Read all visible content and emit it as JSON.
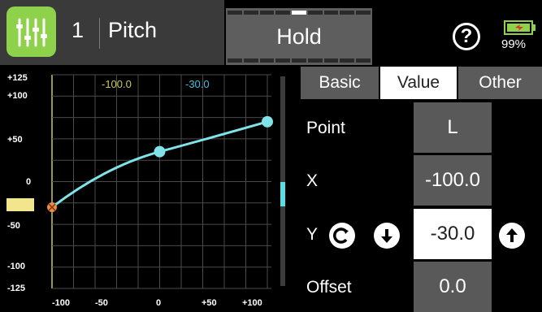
{
  "header": {
    "model_number": "1",
    "function_name": "Pitch",
    "mode_label": "Hold",
    "help_label": "?",
    "battery_percent": "99%"
  },
  "graph": {
    "y_ticks": [
      "+125",
      "+100",
      "+50",
      "0",
      "-50",
      "-100",
      "-125"
    ],
    "x_ticks": [
      "-100",
      "-50",
      "0",
      "+50",
      "+100"
    ],
    "cursor_x_value": "-100.0",
    "cursor_y_value": "-30.0"
  },
  "chart_data": {
    "type": "line",
    "x": [
      -100,
      0,
      100
    ],
    "y": [
      -30,
      35,
      70
    ],
    "xlim": [
      -125,
      125
    ],
    "ylim": [
      -125,
      125
    ],
    "grid": true
  },
  "tabs": [
    {
      "label": "Basic",
      "active": false
    },
    {
      "label": "Value",
      "active": true
    },
    {
      "label": "Other",
      "active": false
    }
  ],
  "fields": {
    "point_label": "Point",
    "point_value": "L",
    "x_label": "X",
    "x_value": "-100.0",
    "y_label": "Y",
    "y_value": "-30.0",
    "offset_label": "Offset",
    "offset_value": "0.0"
  },
  "colors": {
    "accent_green": "#8ed14a",
    "curve_cyan": "#7fe3e8",
    "cursor_yellow": "#c9c95a",
    "point_orange": "#f08a4b"
  },
  "icons": {
    "app": "mixer-sliders-icon",
    "help": "help-icon",
    "battery": "battery-icon",
    "reset": "reset-icon",
    "down": "arrow-down-icon",
    "up": "arrow-up-icon"
  }
}
